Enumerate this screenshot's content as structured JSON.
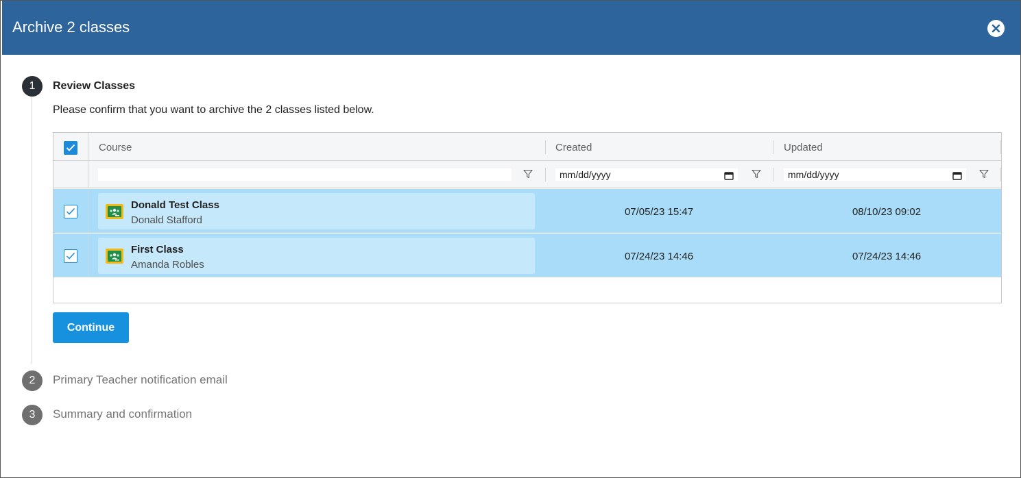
{
  "dialog": {
    "title": "Archive 2 classes",
    "close_icon": "close-icon"
  },
  "steps": [
    {
      "number": "1",
      "title": "Review Classes",
      "state": "active"
    },
    {
      "number": "2",
      "title": "Primary Teacher notification email",
      "state": "inactive"
    },
    {
      "number": "3",
      "title": "Summary and confirmation",
      "state": "inactive"
    }
  ],
  "review": {
    "description": "Please confirm that you want to archive the 2 classes listed below.",
    "columns": {
      "course": "Course",
      "created": "Created",
      "updated": "Updated"
    },
    "filters": {
      "course_value": "",
      "created_value": "mm/dd/yyyy",
      "updated_value": "mm/dd/yyyy"
    },
    "select_all_checked": true,
    "rows": [
      {
        "name": "Donald Test Class",
        "teacher": "Donald Stafford",
        "created": "07/05/23 15:47",
        "updated": "08/10/23 09:02",
        "checked": true
      },
      {
        "name": "First Class",
        "teacher": "Amanda Robles",
        "created": "07/24/23 14:46",
        "updated": "07/24/23 14:46",
        "checked": true
      }
    ],
    "continue_label": "Continue"
  },
  "colors": {
    "header": "#2e649c",
    "accent": "#1790de",
    "row_selected": "#a9dcf8"
  }
}
